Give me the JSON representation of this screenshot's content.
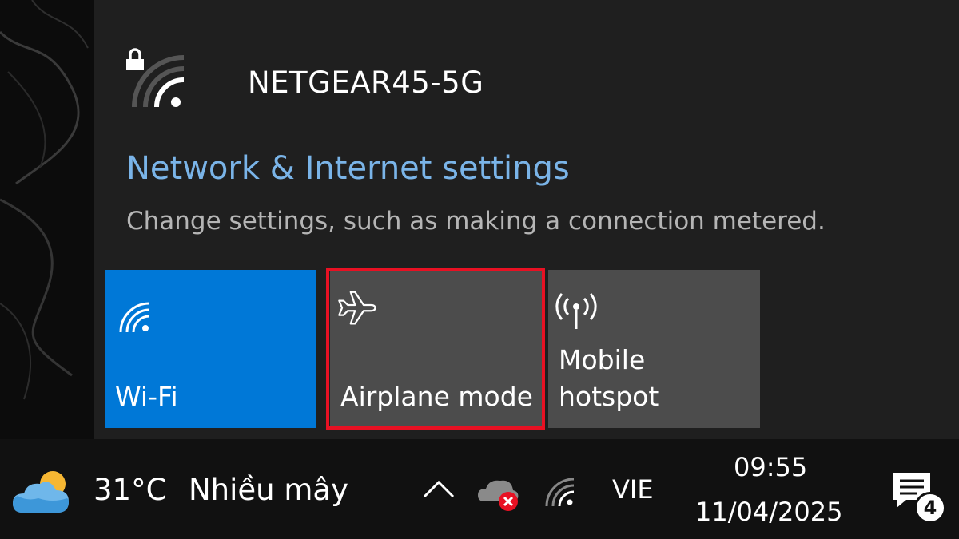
{
  "flyout": {
    "network_name": "NETGEAR45-5G",
    "network_secured_icon": "lock-icon",
    "settings_link": "Network & Internet settings",
    "settings_description": "Change settings, such as making a connection metered."
  },
  "tiles": [
    {
      "label": "Wi-Fi",
      "icon": "wifi-icon",
      "state": "on",
      "color": "#0078d7"
    },
    {
      "label": "Airplane mode",
      "icon": "airplane-icon",
      "state": "off",
      "color": "#4c4c4c"
    },
    {
      "label": "Mobile\nhotspot",
      "icon": "hotspot-icon",
      "state": "off",
      "color": "#4c4c4c"
    }
  ],
  "highlight": {
    "target": "Airplane mode",
    "color": "#e81123"
  },
  "taskbar": {
    "weather_icon": "partly-cloudy-icon",
    "temperature": "31°C",
    "condition": "Nhiều mây",
    "language": "VIE",
    "time": "09:55",
    "date": "11/04/2025",
    "notification_count": "4"
  },
  "colors": {
    "accent": "#0078d7",
    "link": "#7ab4e8",
    "flyout_bg": "#1f1f1f",
    "taskbar_bg": "#111111"
  }
}
